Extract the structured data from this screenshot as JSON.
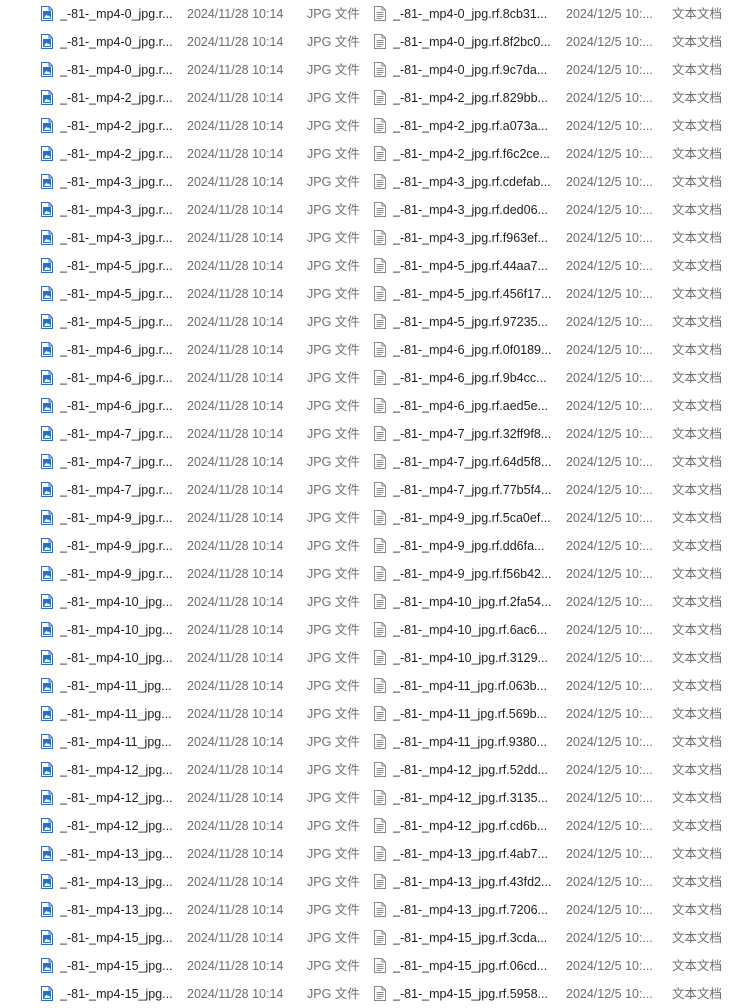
{
  "icons": {
    "jpg": "jpg-file-icon",
    "txt": "text-file-icon"
  },
  "colors": {
    "jpg_icon": "#2b6fc7",
    "txt_icon": "#8a8a8a",
    "meta_text": "#6d6d6d",
    "name_text": "#1f1f1f"
  },
  "rows": [
    {
      "left": {
        "name": "_-81-_mp4-0_jpg.r...",
        "date": "2024/11/28 10:14",
        "type": "JPG 文件"
      },
      "right": {
        "name": "_-81-_mp4-0_jpg.rf.8cb31...",
        "date": "2024/12/5 10:...",
        "type": "文本文档"
      }
    },
    {
      "left": {
        "name": "_-81-_mp4-0_jpg.r...",
        "date": "2024/11/28 10:14",
        "type": "JPG 文件"
      },
      "right": {
        "name": "_-81-_mp4-0_jpg.rf.8f2bc0...",
        "date": "2024/12/5 10:...",
        "type": "文本文档"
      }
    },
    {
      "left": {
        "name": "_-81-_mp4-0_jpg.r...",
        "date": "2024/11/28 10:14",
        "type": "JPG 文件"
      },
      "right": {
        "name": "_-81-_mp4-0_jpg.rf.9c7da...",
        "date": "2024/12/5 10:...",
        "type": "文本文档"
      }
    },
    {
      "left": {
        "name": "_-81-_mp4-2_jpg.r...",
        "date": "2024/11/28 10:14",
        "type": "JPG 文件"
      },
      "right": {
        "name": "_-81-_mp4-2_jpg.rf.829bb...",
        "date": "2024/12/5 10:...",
        "type": "文本文档"
      }
    },
    {
      "left": {
        "name": "_-81-_mp4-2_jpg.r...",
        "date": "2024/11/28 10:14",
        "type": "JPG 文件"
      },
      "right": {
        "name": "_-81-_mp4-2_jpg.rf.a073a...",
        "date": "2024/12/5 10:...",
        "type": "文本文档"
      }
    },
    {
      "left": {
        "name": "_-81-_mp4-2_jpg.r...",
        "date": "2024/11/28 10:14",
        "type": "JPG 文件"
      },
      "right": {
        "name": "_-81-_mp4-2_jpg.rf.f6c2ce...",
        "date": "2024/12/5 10:...",
        "type": "文本文档"
      }
    },
    {
      "left": {
        "name": "_-81-_mp4-3_jpg.r...",
        "date": "2024/11/28 10:14",
        "type": "JPG 文件"
      },
      "right": {
        "name": "_-81-_mp4-3_jpg.rf.cdefab...",
        "date": "2024/12/5 10:...",
        "type": "文本文档"
      }
    },
    {
      "left": {
        "name": "_-81-_mp4-3_jpg.r...",
        "date": "2024/11/28 10:14",
        "type": "JPG 文件"
      },
      "right": {
        "name": "_-81-_mp4-3_jpg.rf.ded06...",
        "date": "2024/12/5 10:...",
        "type": "文本文档"
      }
    },
    {
      "left": {
        "name": "_-81-_mp4-3_jpg.r...",
        "date": "2024/11/28 10:14",
        "type": "JPG 文件"
      },
      "right": {
        "name": "_-81-_mp4-3_jpg.rf.f963ef...",
        "date": "2024/12/5 10:...",
        "type": "文本文档"
      }
    },
    {
      "left": {
        "name": "_-81-_mp4-5_jpg.r...",
        "date": "2024/11/28 10:14",
        "type": "JPG 文件"
      },
      "right": {
        "name": "_-81-_mp4-5_jpg.rf.44aa7...",
        "date": "2024/12/5 10:...",
        "type": "文本文档"
      }
    },
    {
      "left": {
        "name": "_-81-_mp4-5_jpg.r...",
        "date": "2024/11/28 10:14",
        "type": "JPG 文件"
      },
      "right": {
        "name": "_-81-_mp4-5_jpg.rf.456f17...",
        "date": "2024/12/5 10:...",
        "type": "文本文档"
      }
    },
    {
      "left": {
        "name": "_-81-_mp4-5_jpg.r...",
        "date": "2024/11/28 10:14",
        "type": "JPG 文件"
      },
      "right": {
        "name": "_-81-_mp4-5_jpg.rf.97235...",
        "date": "2024/12/5 10:...",
        "type": "文本文档"
      }
    },
    {
      "left": {
        "name": "_-81-_mp4-6_jpg.r...",
        "date": "2024/11/28 10:14",
        "type": "JPG 文件"
      },
      "right": {
        "name": "_-81-_mp4-6_jpg.rf.0f0189...",
        "date": "2024/12/5 10:...",
        "type": "文本文档"
      }
    },
    {
      "left": {
        "name": "_-81-_mp4-6_jpg.r...",
        "date": "2024/11/28 10:14",
        "type": "JPG 文件"
      },
      "right": {
        "name": "_-81-_mp4-6_jpg.rf.9b4cc...",
        "date": "2024/12/5 10:...",
        "type": "文本文档"
      }
    },
    {
      "left": {
        "name": "_-81-_mp4-6_jpg.r...",
        "date": "2024/11/28 10:14",
        "type": "JPG 文件"
      },
      "right": {
        "name": "_-81-_mp4-6_jpg.rf.aed5e...",
        "date": "2024/12/5 10:...",
        "type": "文本文档"
      }
    },
    {
      "left": {
        "name": "_-81-_mp4-7_jpg.r...",
        "date": "2024/11/28 10:14",
        "type": "JPG 文件"
      },
      "right": {
        "name": "_-81-_mp4-7_jpg.rf.32ff9f8...",
        "date": "2024/12/5 10:...",
        "type": "文本文档"
      }
    },
    {
      "left": {
        "name": "_-81-_mp4-7_jpg.r...",
        "date": "2024/11/28 10:14",
        "type": "JPG 文件"
      },
      "right": {
        "name": "_-81-_mp4-7_jpg.rf.64d5f8...",
        "date": "2024/12/5 10:...",
        "type": "文本文档"
      }
    },
    {
      "left": {
        "name": "_-81-_mp4-7_jpg.r...",
        "date": "2024/11/28 10:14",
        "type": "JPG 文件"
      },
      "right": {
        "name": "_-81-_mp4-7_jpg.rf.77b5f4...",
        "date": "2024/12/5 10:...",
        "type": "文本文档"
      }
    },
    {
      "left": {
        "name": "_-81-_mp4-9_jpg.r...",
        "date": "2024/11/28 10:14",
        "type": "JPG 文件"
      },
      "right": {
        "name": "_-81-_mp4-9_jpg.rf.5ca0ef...",
        "date": "2024/12/5 10:...",
        "type": "文本文档"
      }
    },
    {
      "left": {
        "name": "_-81-_mp4-9_jpg.r...",
        "date": "2024/11/28 10:14",
        "type": "JPG 文件"
      },
      "right": {
        "name": "_-81-_mp4-9_jpg.rf.dd6fa...",
        "date": "2024/12/5 10:...",
        "type": "文本文档"
      }
    },
    {
      "left": {
        "name": "_-81-_mp4-9_jpg.r...",
        "date": "2024/11/28 10:14",
        "type": "JPG 文件"
      },
      "right": {
        "name": "_-81-_mp4-9_jpg.rf.f56b42...",
        "date": "2024/12/5 10:...",
        "type": "文本文档"
      }
    },
    {
      "left": {
        "name": "_-81-_mp4-10_jpg...",
        "date": "2024/11/28 10:14",
        "type": "JPG 文件"
      },
      "right": {
        "name": "_-81-_mp4-10_jpg.rf.2fa54...",
        "date": "2024/12/5 10:...",
        "type": "文本文档"
      }
    },
    {
      "left": {
        "name": "_-81-_mp4-10_jpg...",
        "date": "2024/11/28 10:14",
        "type": "JPG 文件"
      },
      "right": {
        "name": "_-81-_mp4-10_jpg.rf.6ac6...",
        "date": "2024/12/5 10:...",
        "type": "文本文档"
      }
    },
    {
      "left": {
        "name": "_-81-_mp4-10_jpg...",
        "date": "2024/11/28 10:14",
        "type": "JPG 文件"
      },
      "right": {
        "name": "_-81-_mp4-10_jpg.rf.3129...",
        "date": "2024/12/5 10:...",
        "type": "文本文档"
      }
    },
    {
      "left": {
        "name": "_-81-_mp4-11_jpg...",
        "date": "2024/11/28 10:14",
        "type": "JPG 文件"
      },
      "right": {
        "name": "_-81-_mp4-11_jpg.rf.063b...",
        "date": "2024/12/5 10:...",
        "type": "文本文档"
      }
    },
    {
      "left": {
        "name": "_-81-_mp4-11_jpg...",
        "date": "2024/11/28 10:14",
        "type": "JPG 文件"
      },
      "right": {
        "name": "_-81-_mp4-11_jpg.rf.569b...",
        "date": "2024/12/5 10:...",
        "type": "文本文档"
      }
    },
    {
      "left": {
        "name": "_-81-_mp4-11_jpg...",
        "date": "2024/11/28 10:14",
        "type": "JPG 文件"
      },
      "right": {
        "name": "_-81-_mp4-11_jpg.rf.9380...",
        "date": "2024/12/5 10:...",
        "type": "文本文档"
      }
    },
    {
      "left": {
        "name": "_-81-_mp4-12_jpg...",
        "date": "2024/11/28 10:14",
        "type": "JPG 文件"
      },
      "right": {
        "name": "_-81-_mp4-12_jpg.rf.52dd...",
        "date": "2024/12/5 10:...",
        "type": "文本文档"
      }
    },
    {
      "left": {
        "name": "_-81-_mp4-12_jpg...",
        "date": "2024/11/28 10:14",
        "type": "JPG 文件"
      },
      "right": {
        "name": "_-81-_mp4-12_jpg.rf.3135...",
        "date": "2024/12/5 10:...",
        "type": "文本文档"
      }
    },
    {
      "left": {
        "name": "_-81-_mp4-12_jpg...",
        "date": "2024/11/28 10:14",
        "type": "JPG 文件"
      },
      "right": {
        "name": "_-81-_mp4-12_jpg.rf.cd6b...",
        "date": "2024/12/5 10:...",
        "type": "文本文档"
      }
    },
    {
      "left": {
        "name": "_-81-_mp4-13_jpg...",
        "date": "2024/11/28 10:14",
        "type": "JPG 文件"
      },
      "right": {
        "name": "_-81-_mp4-13_jpg.rf.4ab7...",
        "date": "2024/12/5 10:...",
        "type": "文本文档"
      }
    },
    {
      "left": {
        "name": "_-81-_mp4-13_jpg...",
        "date": "2024/11/28 10:14",
        "type": "JPG 文件"
      },
      "right": {
        "name": "_-81-_mp4-13_jpg.rf.43fd2...",
        "date": "2024/12/5 10:...",
        "type": "文本文档"
      }
    },
    {
      "left": {
        "name": "_-81-_mp4-13_jpg...",
        "date": "2024/11/28 10:14",
        "type": "JPG 文件"
      },
      "right": {
        "name": "_-81-_mp4-13_jpg.rf.7206...",
        "date": "2024/12/5 10:...",
        "type": "文本文档"
      }
    },
    {
      "left": {
        "name": "_-81-_mp4-15_jpg...",
        "date": "2024/11/28 10:14",
        "type": "JPG 文件"
      },
      "right": {
        "name": "_-81-_mp4-15_jpg.rf.3cda...",
        "date": "2024/12/5 10:...",
        "type": "文本文档"
      }
    },
    {
      "left": {
        "name": "_-81-_mp4-15_jpg...",
        "date": "2024/11/28 10:14",
        "type": "JPG 文件"
      },
      "right": {
        "name": "_-81-_mp4-15_jpg.rf.06cd...",
        "date": "2024/12/5 10:...",
        "type": "文本文档"
      }
    },
    {
      "left": {
        "name": "_-81-_mp4-15_jpg...",
        "date": "2024/11/28 10:14",
        "type": "JPG 文件"
      },
      "right": {
        "name": "_-81-_mp4-15_jpg.rf.5958...",
        "date": "2024/12/5 10:...",
        "type": "文本文档"
      }
    }
  ]
}
